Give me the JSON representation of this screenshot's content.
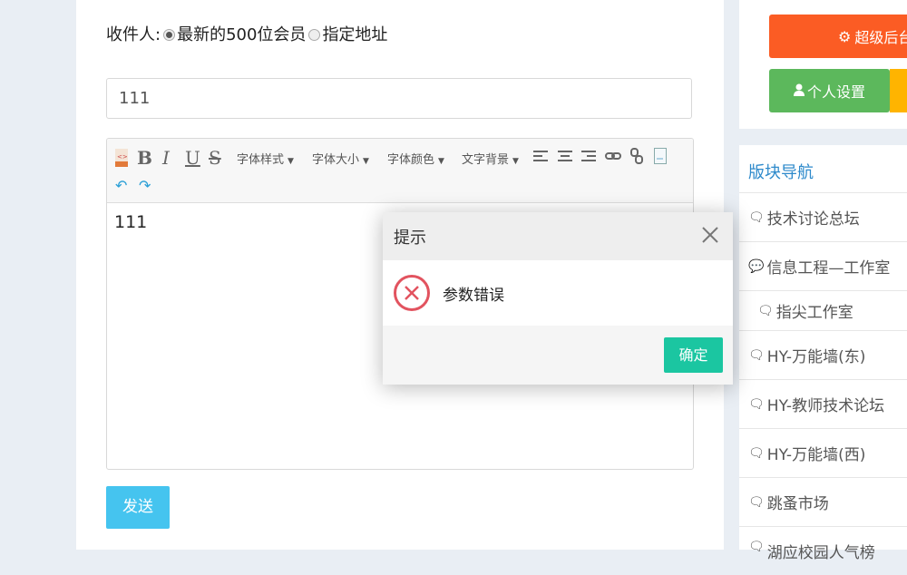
{
  "form": {
    "recipient_label": "收件人:",
    "option_latest": "最新的500位会员",
    "option_address": "指定地址",
    "subject_value": "111",
    "editor_content": "111",
    "send_label": "发送"
  },
  "toolbar": {
    "font_style": "字体样式",
    "font_size": "字体大小",
    "font_color": "字体颜色",
    "text_background": "文字背景"
  },
  "sidebar": {
    "super_admin": "超级后台",
    "personal_settings": "个人设置",
    "nav_title": "版块导航",
    "items": [
      {
        "label": "技术讨论总坛"
      },
      {
        "label": "信息工程—工作室"
      },
      {
        "label": "指尖工作室"
      },
      {
        "label": "HY-万能墙(东)"
      },
      {
        "label": "HY-教师技术论坛"
      },
      {
        "label": "HY-万能墙(西)"
      },
      {
        "label": "跳蚤市场"
      },
      {
        "label": "湖应校园人气榜"
      }
    ]
  },
  "dialog": {
    "title": "提示",
    "message": "参数错误",
    "ok_label": "确定"
  },
  "colors": {
    "super_admin_bg": "#fb5c24",
    "personal_bg": "#5cb85c",
    "send_bg": "#45c4ef",
    "ok_bg": "#1bc6a1",
    "error": "#e2535f",
    "nav_title": "#2e8acb"
  }
}
